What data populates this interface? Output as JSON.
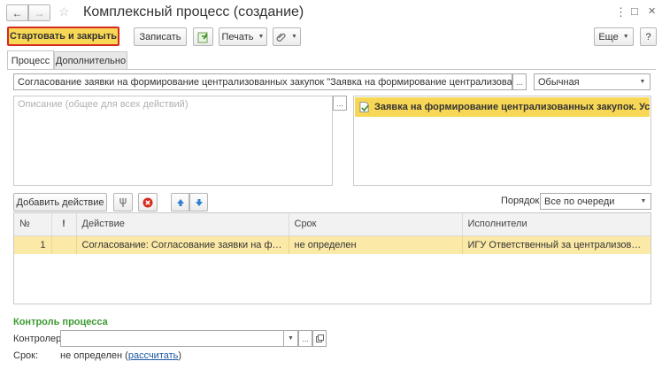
{
  "window": {
    "title": "Комплексный процесс (создание)",
    "nav_back": "←",
    "nav_forward": "→",
    "star": "☆",
    "menu_dots": "⋮",
    "maximize": "□",
    "close": "✕"
  },
  "toolbar": {
    "start_close": "Стартовать и закрыть",
    "save": "Записать",
    "print": "Печать",
    "more": "Еще",
    "help": "?"
  },
  "tabs": [
    "Процесс",
    "Дополнительно"
  ],
  "form": {
    "subject": "Согласование заявки на формирование централизованных закупок \"Заявка на формирование централизованных закупок. Усл",
    "priority": "Обычная",
    "description_placeholder": "Описание (общее для всех действий)",
    "attachment": "Заявка на формирование централизованных закупок. Услуг...",
    "ellipsis": "..."
  },
  "actions": {
    "add_action": "Добавить действие",
    "order_label": "Порядок:",
    "order_value": "Все по очереди"
  },
  "table": {
    "headers": [
      "№",
      "!",
      "Действие",
      "Срок",
      "Исполнители"
    ],
    "rows": [
      {
        "num": "1",
        "flag": "",
        "action": "Согласование: Согласование заявки на формир...",
        "term": "не определен",
        "performers": "ИГУ Ответственный за централизованную з..."
      }
    ]
  },
  "control": {
    "title": "Контроль процесса",
    "controller_label": "Контролер:",
    "controller_value": "",
    "term_label": "Срок:",
    "term_value": "не определен",
    "recalc_open": "(",
    "recalc_link": "рассчитать",
    "recalc_close": ")"
  },
  "colors": {
    "accent_yellow": "#f7d755",
    "highlight_border": "#d52b1e",
    "selected_row": "#fbe9a7",
    "control_title": "#3a9a2f",
    "link": "#1a57a5"
  }
}
